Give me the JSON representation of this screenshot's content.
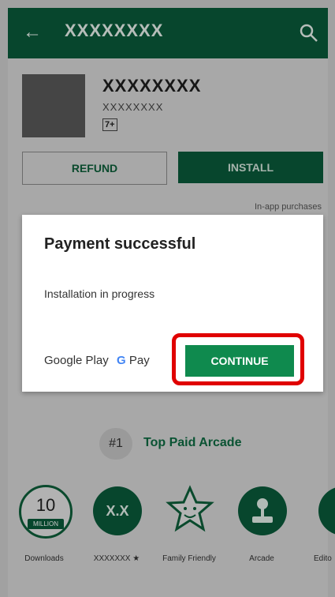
{
  "appbar": {
    "title": "XXXXXXXX",
    "back_icon": "arrow-left-icon",
    "search_icon": "search-icon"
  },
  "app": {
    "name": "XXXXXXXX",
    "developer": "XXXXXXXX",
    "age_rating": "7+"
  },
  "actions": {
    "refund_label": "REFUND",
    "install_label": "INSTALL",
    "purchases_note": "In-app purchases"
  },
  "dialog": {
    "title": "Payment successful",
    "message": "Installation in progress",
    "google_play": "Google Play",
    "g_letter": "G",
    "pay_label": "Pay",
    "continue_label": "CONTINUE"
  },
  "rank": {
    "number": "#1",
    "label": "Top Paid Arcade"
  },
  "badges": [
    {
      "value": "10",
      "sub": "MILLION",
      "caption": "Downloads"
    },
    {
      "value": "X.X",
      "caption": "XXXXXXX ★"
    },
    {
      "caption": "Family Friendly"
    },
    {
      "caption": "Arcade"
    },
    {
      "caption": "Edito"
    }
  ],
  "colors": {
    "accent": "#0a5a3a",
    "continue": "#0f8a4e",
    "highlight": "#e00000"
  }
}
